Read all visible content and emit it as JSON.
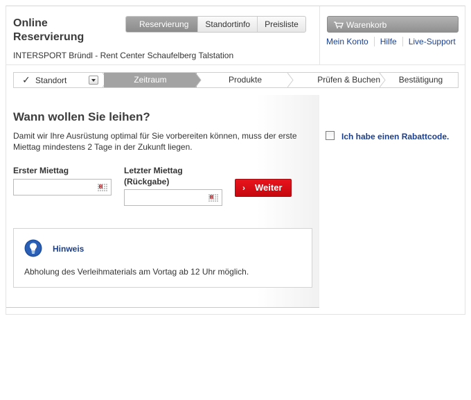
{
  "header": {
    "title": "Online Reservierung",
    "shop_name": "INTERSPORT Bründl - Rent Center Schaufelberg Talstation",
    "nav_tabs": [
      {
        "label": "Reservierung",
        "active": true
      },
      {
        "label": "Standortinfo",
        "active": false
      },
      {
        "label": "Preisliste",
        "active": false
      }
    ],
    "cart_label": "Warenkorb",
    "links": [
      "Mein Konto",
      "Hilfe",
      "Live-Support"
    ]
  },
  "steps": [
    {
      "label": "Standort",
      "state": "done"
    },
    {
      "label": "Zeitraum",
      "state": "active"
    },
    {
      "label": "Produkte",
      "state": "todo"
    },
    {
      "label": "Prüfen & Buchen",
      "state": "todo"
    },
    {
      "label": "Bestätigung",
      "state": "todo"
    }
  ],
  "main": {
    "heading": "Wann wollen Sie leihen?",
    "intro": "Damit wir Ihre Ausrüstung optimal für Sie vorbereiten können, muss der erste Miettag mindestens 2 Tage in der Zukunft liegen.",
    "first_day_label": "Erster Miettag",
    "first_day_value": "",
    "last_day_label_line1": "Letzter Miettag",
    "last_day_label_line2": "(Rückgabe)",
    "last_day_value": "",
    "weiter_label": "Weiter",
    "hint_title": "Hinweis",
    "hint_text": "Abholung des Verleihmaterials am Vortag ab 12 Uhr möglich."
  },
  "sidebar": {
    "rabatt_label": "Ich habe einen Rabattcode.",
    "rabatt_checked": false
  },
  "colors": {
    "link_blue": "#1a3f8f",
    "accent_red": "#d30c14",
    "active_step_grey": "#a3a3a3"
  }
}
